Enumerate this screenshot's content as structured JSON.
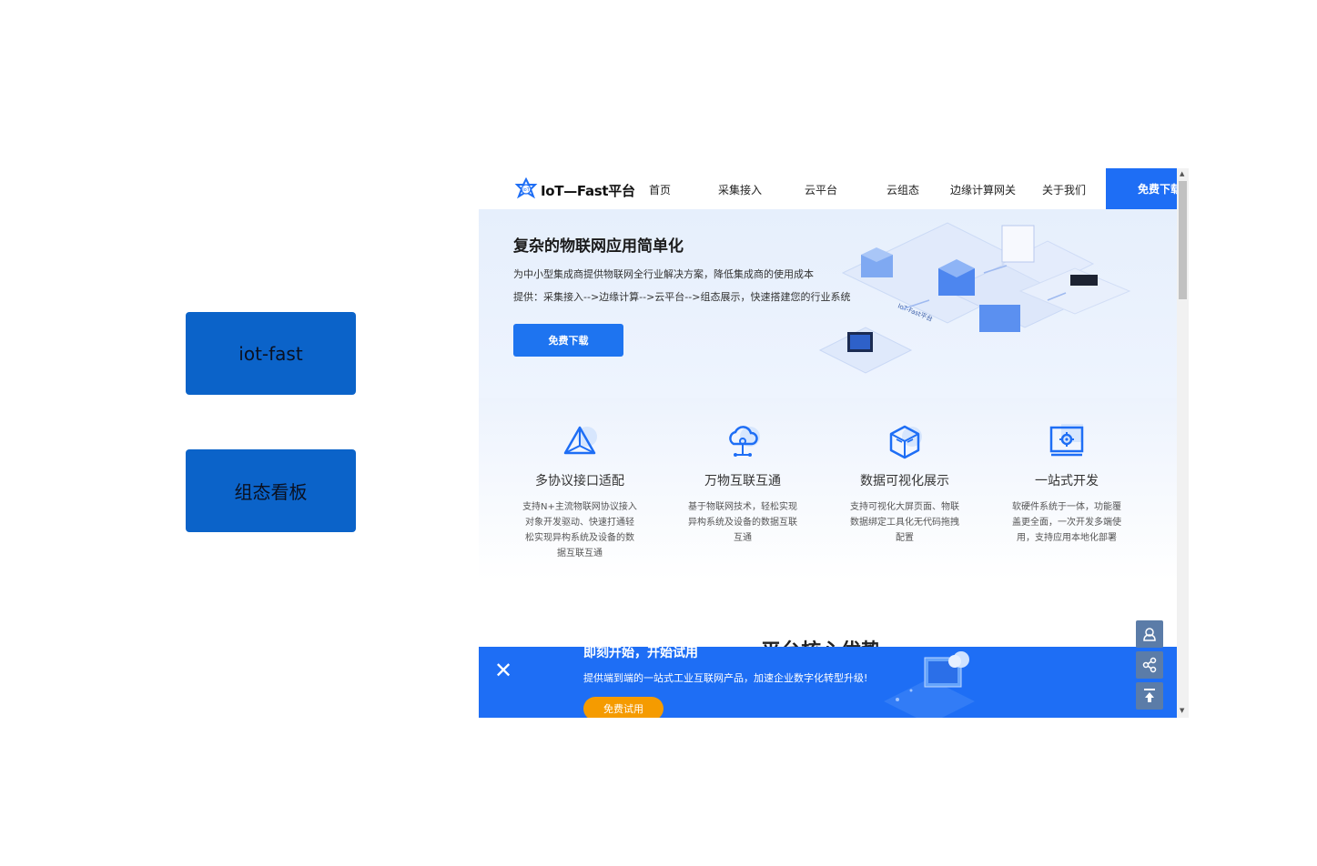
{
  "side_buttons": {
    "iot_fast": "iot-fast",
    "dashboard": "组态看板"
  },
  "nav": {
    "logo_text": "IoT—Fast平台",
    "items": [
      "首页",
      "采集接入",
      "云平台",
      "云组态",
      "边缘计算网关",
      "关于我们"
    ],
    "cta": "免费下载"
  },
  "hero": {
    "title": "复杂的物联网应用简单化",
    "line1": "为中小型集成商提供物联网全行业解决方案，降低集成商的使用成本",
    "line2": "提供：采集接入-->边缘计算-->云平台-->组态展示，快速搭建您的行业系统",
    "button": "免费下载",
    "art_label": "IoT-Fast平台"
  },
  "features": [
    {
      "title": "多协议接口适配",
      "desc": "支持N+主流物联网协议接入对象开发驱动、快速打通轻松实现异构系统及设备的数据互联互通",
      "icon": "protocol-icon"
    },
    {
      "title": "万物互联互通",
      "desc": "基于物联网技术，轻松实现异构系统及设备的数据互联互通",
      "icon": "cloud-network-icon"
    },
    {
      "title": "数据可视化展示",
      "desc": "支持可视化大屏页面、物联数据绑定工具化无代码拖拽配置",
      "icon": "cube-icon"
    },
    {
      "title": "一站式开发",
      "desc": "软硬件系统于一体，功能覆盖更全面，一次开发多端使用，支持应用本地化部署",
      "icon": "gear-monitor-icon"
    }
  ],
  "core_title": "平台核心优势",
  "banner": {
    "headline": "即刻开始，开始试用",
    "sub": "提供端到端的一站式工业互联网产品，加速企业数字化转型升级!",
    "button": "免费试用",
    "close": "✕"
  },
  "colors": {
    "side_button": "#0b63c9",
    "brand_blue": "#1e6ef5",
    "trial_orange": "#f59b00"
  }
}
